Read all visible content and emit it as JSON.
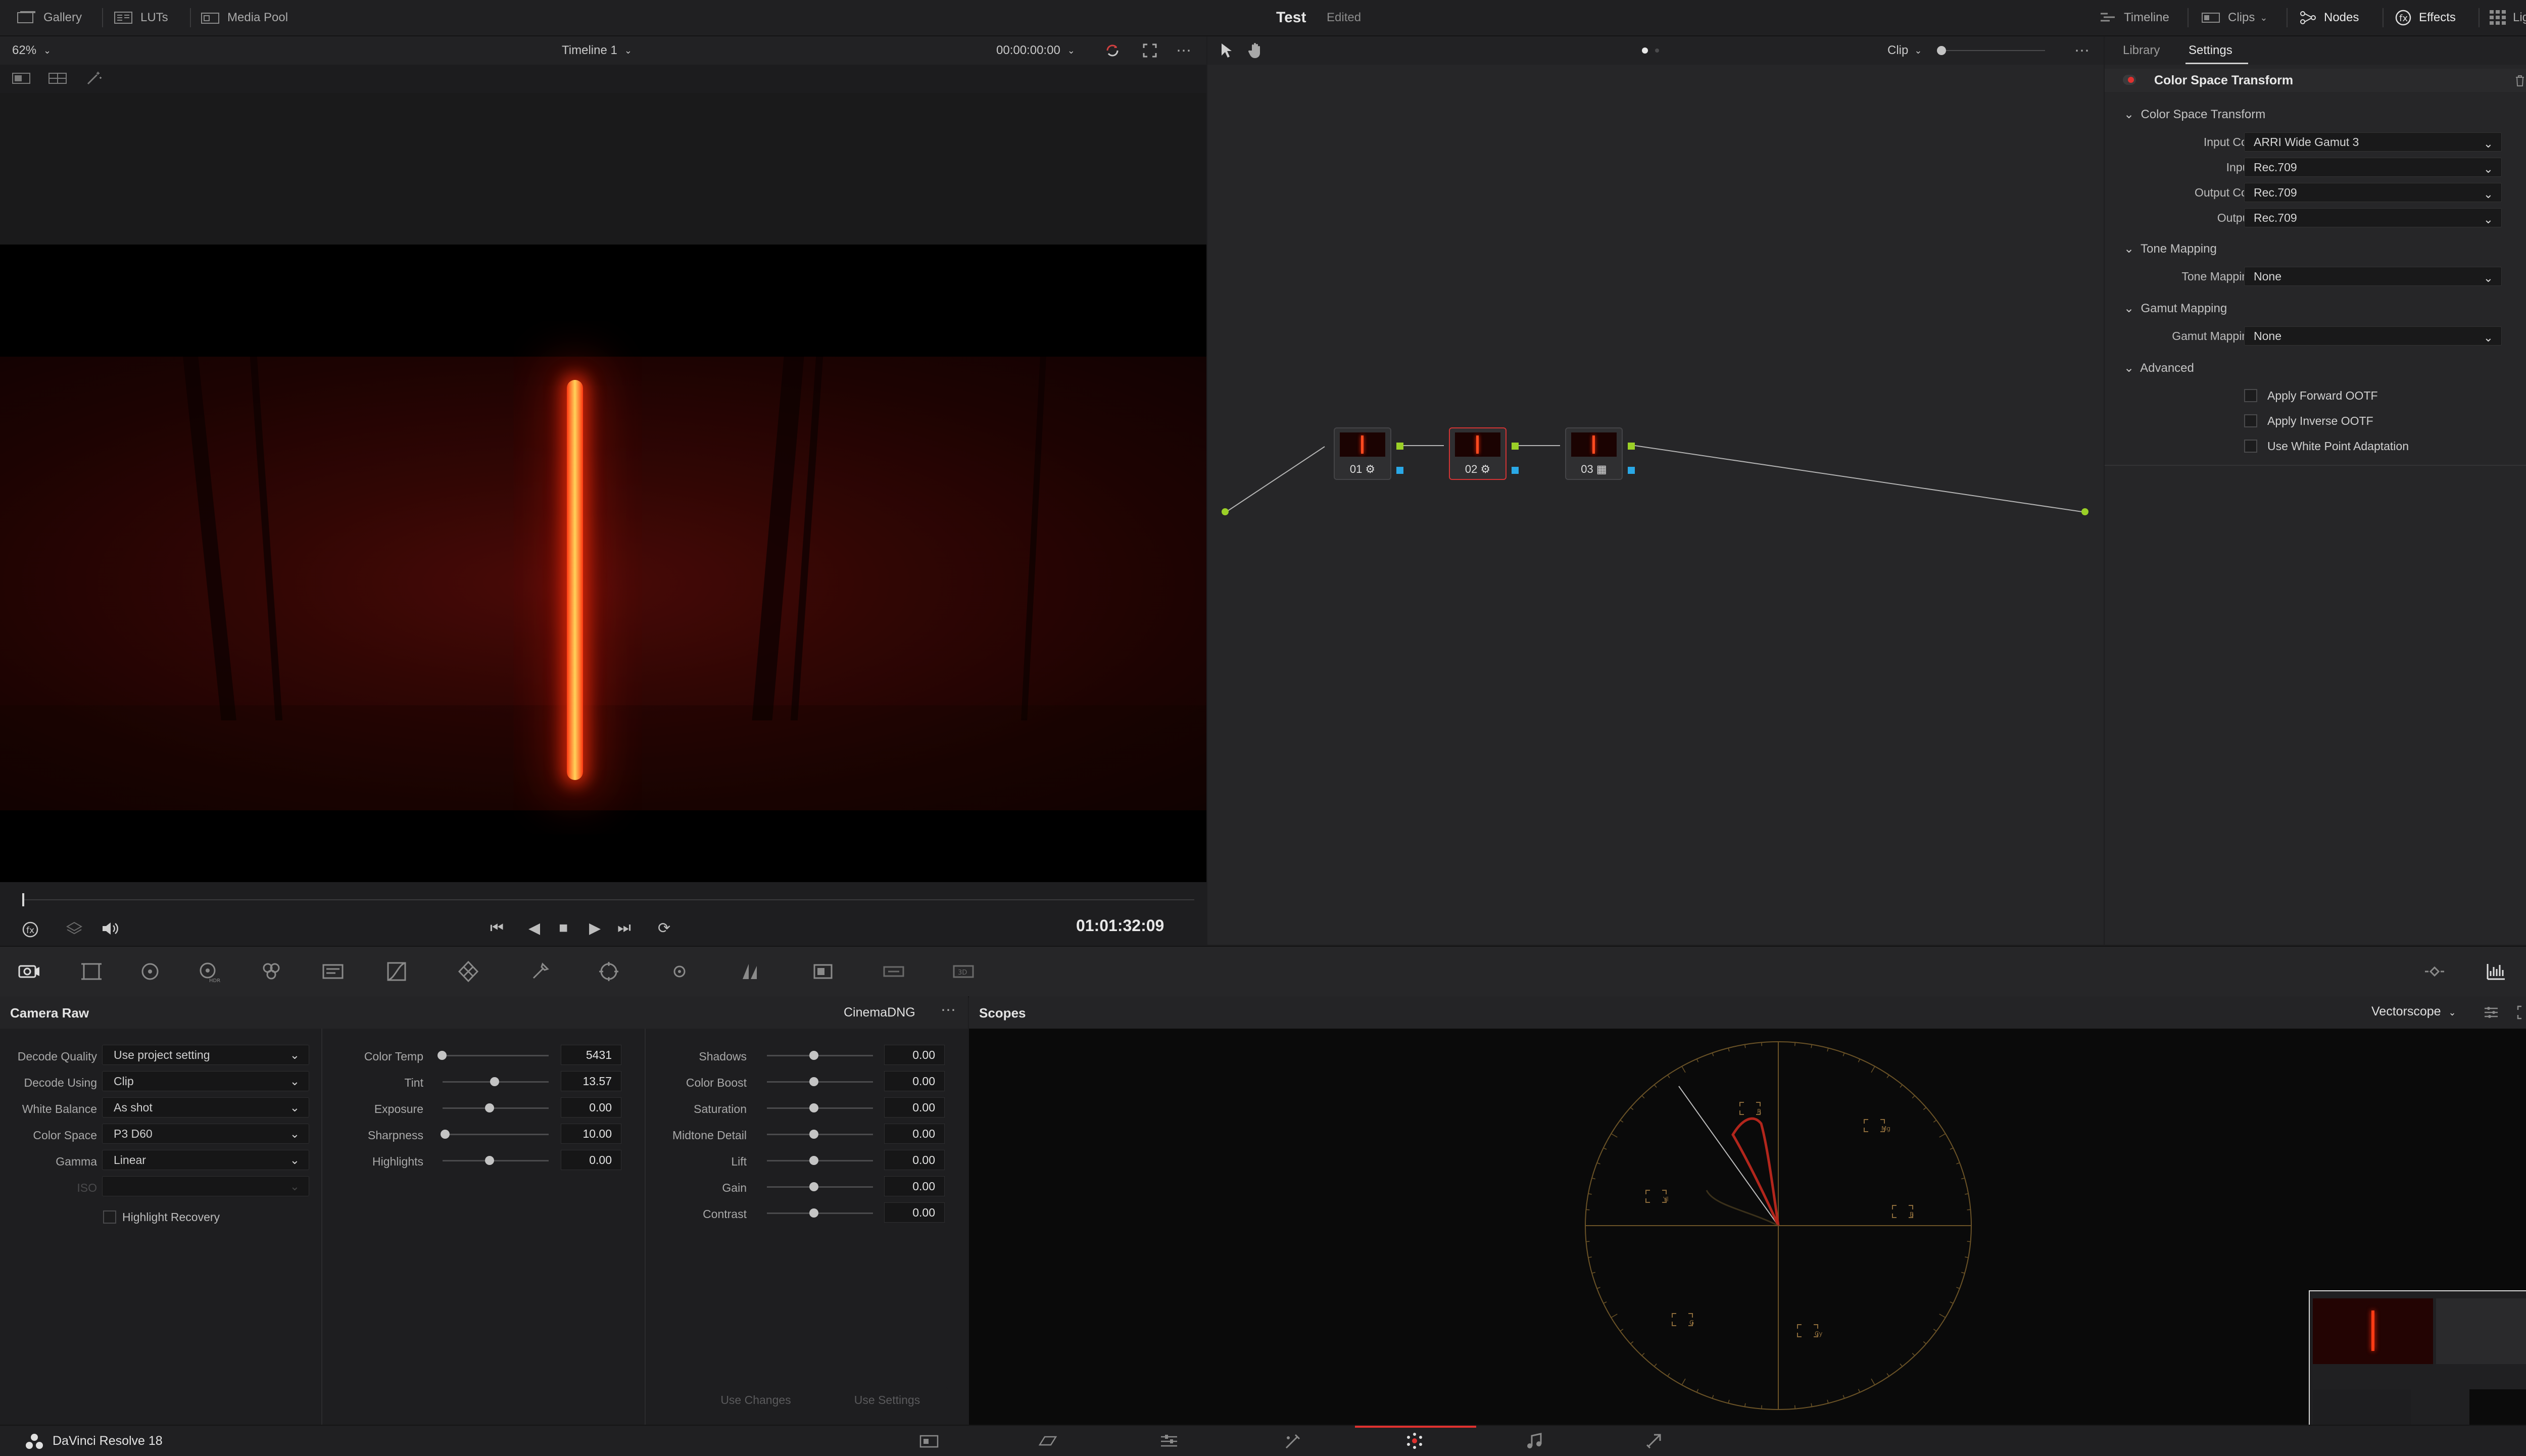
{
  "topbar": {
    "gallery": "Gallery",
    "luts": "LUTs",
    "media_pool": "Media Pool",
    "project_title": "Test",
    "project_status": "Edited",
    "timeline": "Timeline",
    "clips": "Clips",
    "nodes": "Nodes",
    "effects": "Effects",
    "lightbox": "Lightbox"
  },
  "viewer": {
    "zoom": "62%",
    "timeline_name": "Timeline 1",
    "source_timecode": "00:00:00:00",
    "record_timecode": "01:01:32:09"
  },
  "node_editor": {
    "mode": "Clip",
    "nodes": [
      {
        "label": "01"
      },
      {
        "label": "02"
      },
      {
        "label": "03"
      }
    ]
  },
  "right_panel": {
    "tab_library": "Library",
    "tab_settings": "Settings",
    "effect_title": "Color Space Transform",
    "section_cst": "Color Space Transform",
    "input_color_space_label": "Input Color Space",
    "input_color_space": "ARRI Wide Gamut 3",
    "input_gamma_label": "Input Gamma",
    "input_gamma": "Rec.709",
    "output_color_space_label": "Output Color Space",
    "output_color_space": "Rec.709",
    "output_gamma_label": "Output Gamma",
    "output_gamma": "Rec.709",
    "section_tone": "Tone Mapping",
    "tone_method_label": "Tone Mapping Method",
    "tone_method": "None",
    "section_gamut": "Gamut Mapping",
    "gamut_method_label": "Gamut Mapping Method",
    "gamut_method": "None",
    "section_advanced": "Advanced",
    "apply_forward_ootf": "Apply Forward OOTF",
    "apply_inverse_ootf": "Apply Inverse OOTF",
    "use_white_point": "Use White Point Adaptation"
  },
  "camera_raw": {
    "title": "Camera Raw",
    "format": "CinemaDNG",
    "decode_quality_label": "Decode Quality",
    "decode_quality": "Use project setting",
    "decode_using_label": "Decode Using",
    "decode_using": "Clip",
    "white_balance_label": "White Balance",
    "white_balance": "As shot",
    "color_space_label": "Color Space",
    "color_space": "P3 D60",
    "gamma_label": "Gamma",
    "gamma": "Linear",
    "iso_label": "ISO",
    "highlight_recovery": "Highlight Recovery",
    "color_temp_label": "Color Temp",
    "color_temp": "5431",
    "tint_label": "Tint",
    "tint": "13.57",
    "exposure_label": "Exposure",
    "exposure": "0.00",
    "sharpness_label": "Sharpness",
    "sharpness": "10.00",
    "highlights_label": "Highlights",
    "highlights": "0.00",
    "shadows_label": "Shadows",
    "shadows": "0.00",
    "color_boost_label": "Color Boost",
    "color_boost": "0.00",
    "saturation_label": "Saturation",
    "saturation": "0.00",
    "midtone_detail_label": "Midtone Detail",
    "midtone_detail": "0.00",
    "lift_label": "Lift",
    "lift": "0.00",
    "gain_label": "Gain",
    "gain": "0.00",
    "contrast_label": "Contrast",
    "contrast": "0.00",
    "use_changes": "Use Changes",
    "use_settings": "Use Settings"
  },
  "scopes": {
    "title": "Scopes",
    "mode": "Vectorscope",
    "targets": [
      "R",
      "Mg",
      "B",
      "Cy",
      "G",
      "Yl"
    ]
  },
  "statusbar": {
    "app_name": "DaVinci Resolve 18"
  },
  "colors": {
    "accent_red": "#e0312f",
    "led": "#ff3a12",
    "node_port_green": "#9bd027",
    "node_port_blue": "#2aa8e6",
    "scope_graticule": "#8a6a3a"
  }
}
